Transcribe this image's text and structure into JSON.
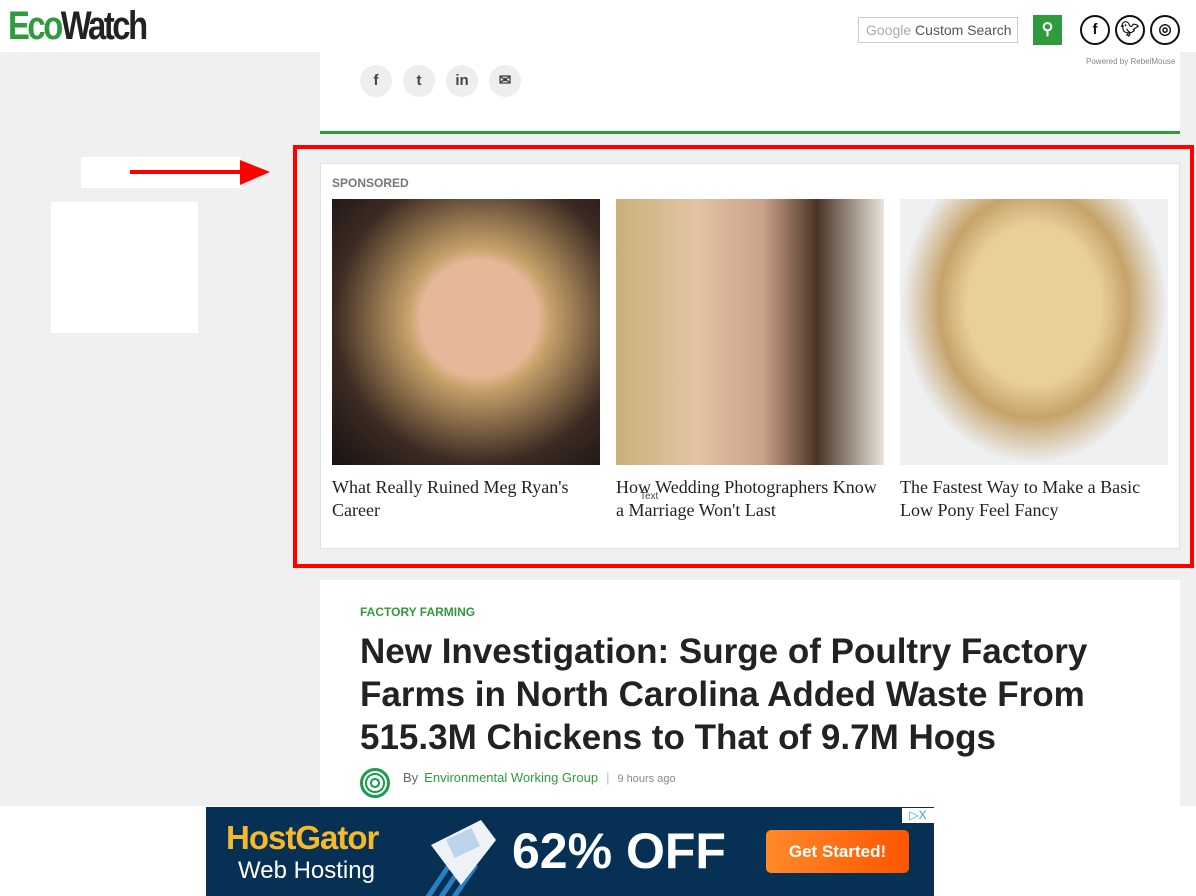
{
  "header": {
    "logo_part1": "Eco",
    "logo_part2": "Watch",
    "search_brand": "Google",
    "search_placeholder": "Custom Search",
    "search_icon": "search-icon",
    "social": [
      "facebook",
      "twitter",
      "instagram"
    ],
    "powered_by": "Powered by RebelMouse"
  },
  "share": {
    "icons": [
      "facebook",
      "twitter",
      "linkedin",
      "email"
    ]
  },
  "sponsored": {
    "label": "SPONSORED",
    "items": [
      {
        "caption": "What Really Ruined Meg Ryan's Career"
      },
      {
        "caption": "How Wedding Photographers Know a Marriage Won't Last"
      },
      {
        "caption": "The Fastest Way to Make a Basic Low Pony Feel Fancy"
      }
    ],
    "overlay_text": "Text"
  },
  "article": {
    "category": "FACTORY FARMING",
    "title": "New Investigation: Surge of Poultry Factory Farms in North Carolina Added Waste From 515.3M Chickens to That of 9.7M Hogs",
    "by": "By",
    "author": "Environmental Working Group",
    "time": "9 hours ago"
  },
  "ad": {
    "brand": "HostGator",
    "sub": "Web Hosting",
    "offer": "62% OFF",
    "cta": "Get Started!",
    "choices": "▷X"
  },
  "colors": {
    "brand_green": "#2e9c3c",
    "highlight": "#ff0000",
    "ad_bg": "#063154"
  }
}
